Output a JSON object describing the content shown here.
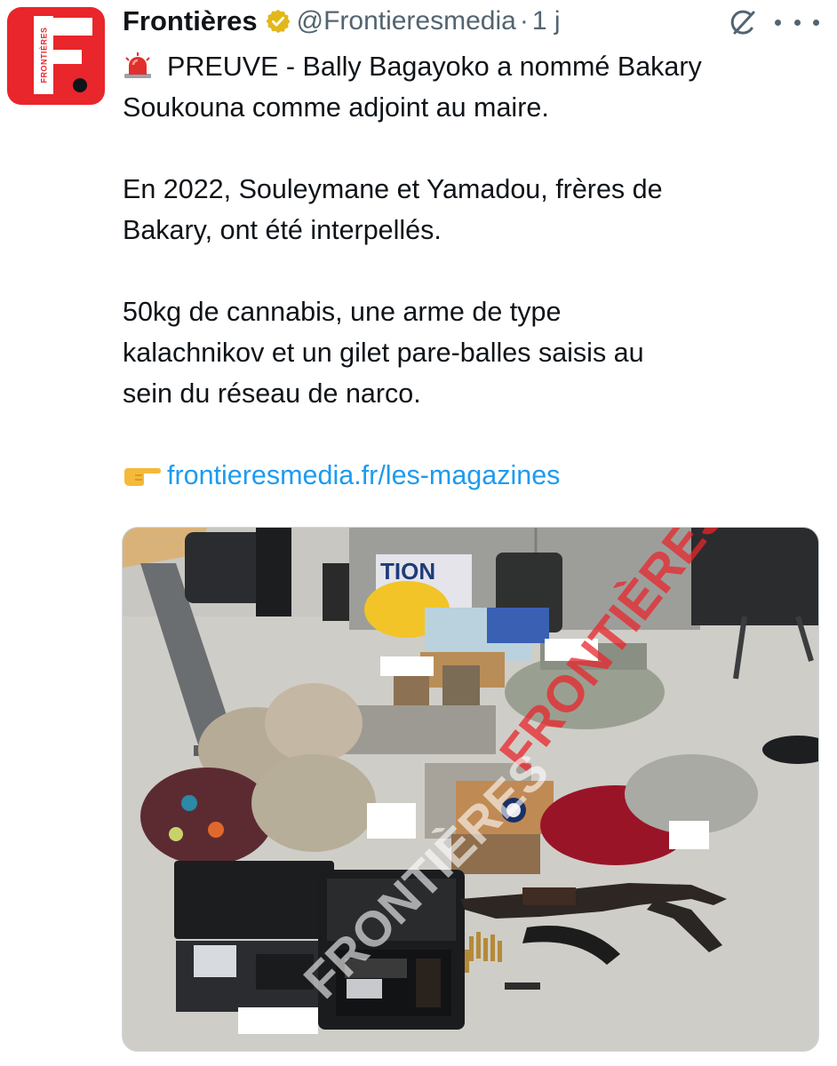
{
  "account": {
    "display_name": "Frontières",
    "handle": "@Frontieresmedia",
    "separator": "·",
    "time_ago": "1 j",
    "avatar_text": "FRONTIÈRES"
  },
  "tweet": {
    "line1_text": "PREUVE - Bally Bagayoko a nommé Bakary",
    "line2": "Soukouna comme adjoint au maire.",
    "line3": "En 2022, Souleymane et Yamadou, frères de",
    "line4": "Bakary, ont été interpellés.",
    "line5": "50kg de cannabis, une arme de type",
    "line6": "kalachnikov et un gilet pare-balles saisis au",
    "line7": "sein du réseau de narco.",
    "link": "frontieresmedia.fr/les-magazines"
  },
  "media": {
    "bag_text": "TION",
    "watermark": "FRONTIÈRES"
  },
  "icons": {
    "verified": "verified-badge-icon",
    "siren": "siren-emoji-icon",
    "hand": "pointing-hand-emoji-icon",
    "grok": "grok-icon",
    "more": "more-icon"
  },
  "colors": {
    "brand_red": "#e8262c",
    "link": "#1d9bf0",
    "secondary_text": "#536471",
    "verified_gold": "#e2b719"
  }
}
